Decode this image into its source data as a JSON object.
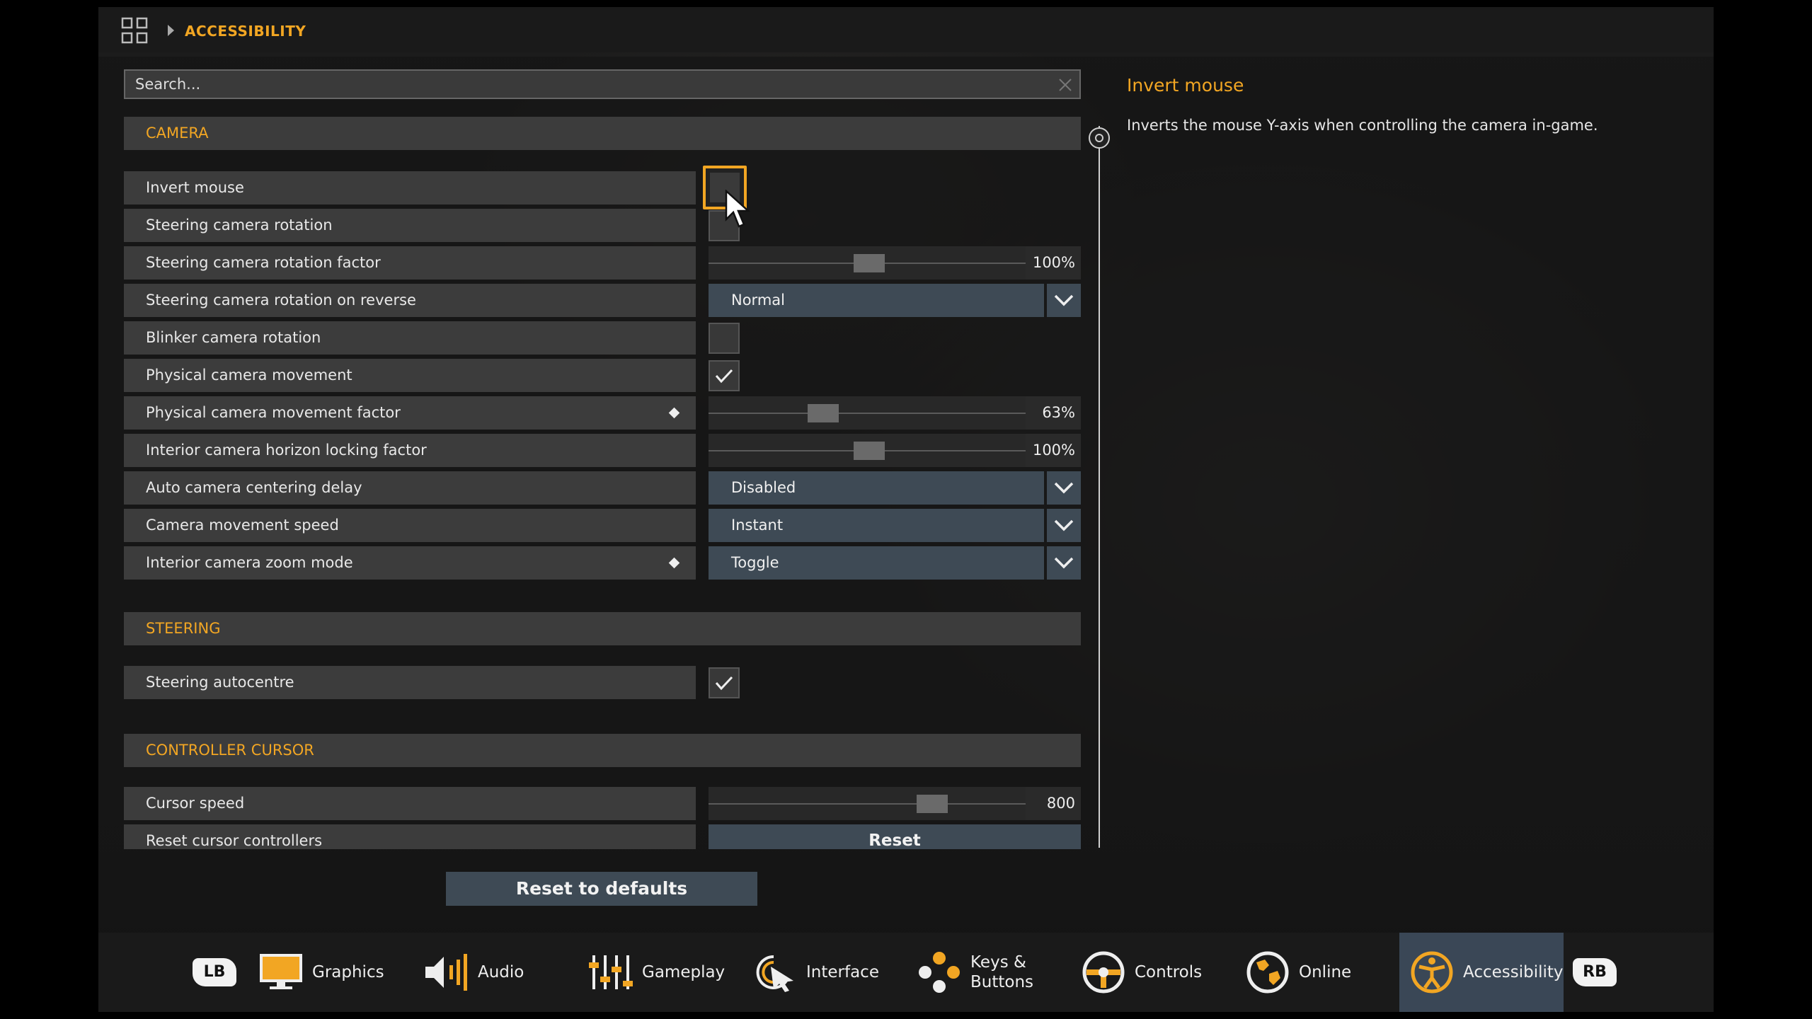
{
  "breadcrumb": {
    "label": "ACCESSIBILITY"
  },
  "search": {
    "placeholder": "Search..."
  },
  "description": {
    "title": "Invert mouse",
    "text": "Inverts the mouse Y-axis when controlling the camera in-game."
  },
  "sections": {
    "camera": "CAMERA",
    "steering": "STEERING",
    "controller_cursor": "CONTROLLER CURSOR"
  },
  "settings": {
    "invert_mouse": {
      "label": "Invert mouse",
      "checked": false
    },
    "steering_camera_rotation": {
      "label": "Steering camera rotation",
      "checked": false
    },
    "steering_camera_rotation_factor": {
      "label": "Steering camera rotation factor",
      "value": "100%",
      "fraction": 0.5
    },
    "steering_camera_rotation_on_reverse": {
      "label": "Steering camera rotation on reverse",
      "value": "Normal"
    },
    "blinker_camera_rotation": {
      "label": "Blinker camera rotation",
      "checked": false
    },
    "physical_camera_movement": {
      "label": "Physical camera movement",
      "checked": true
    },
    "physical_camera_movement_factor": {
      "label": "Physical camera movement factor",
      "value": "63%",
      "fraction": 0.34,
      "modified": true
    },
    "interior_camera_horizon_locking_factor": {
      "label": "Interior camera horizon locking factor",
      "value": "100%",
      "fraction": 0.5
    },
    "auto_camera_centering_delay": {
      "label": "Auto camera centering delay",
      "value": "Disabled"
    },
    "camera_movement_speed": {
      "label": "Camera movement speed",
      "value": "Instant"
    },
    "interior_camera_zoom_mode": {
      "label": "Interior camera zoom mode",
      "value": "Toggle",
      "modified": true
    },
    "steering_autocentre": {
      "label": "Steering autocentre",
      "checked": true
    },
    "cursor_speed": {
      "label": "Cursor speed",
      "value": "800",
      "fraction": 0.72
    },
    "reset_cursor_controllers": {
      "label": "Reset cursor controllers",
      "button": "Reset"
    }
  },
  "reset_defaults": "Reset to defaults",
  "bottom_tabs": {
    "lb": "LB",
    "rb": "RB",
    "graphics": "Graphics",
    "audio": "Audio",
    "gameplay": "Gameplay",
    "interface": "Interface",
    "keys_buttons_1": "Keys &",
    "keys_buttons_2": "Buttons",
    "controls": "Controls",
    "online": "Online",
    "accessibility": "Accessibility"
  },
  "colors": {
    "accent": "#f2a623",
    "panel": "#3c3c3c",
    "control": "#3e4a55",
    "active_tab": "#3a4756"
  },
  "icons": [
    "grid-icon",
    "search-clear-icon",
    "check-icon",
    "chevron-down-icon",
    "monitor-icon",
    "speaker-icon",
    "sliders-icon",
    "pointer-icon",
    "buttons-icon",
    "steering-wheel-icon",
    "globe-icon",
    "accessibility-icon",
    "mouse-cursor-icon"
  ]
}
